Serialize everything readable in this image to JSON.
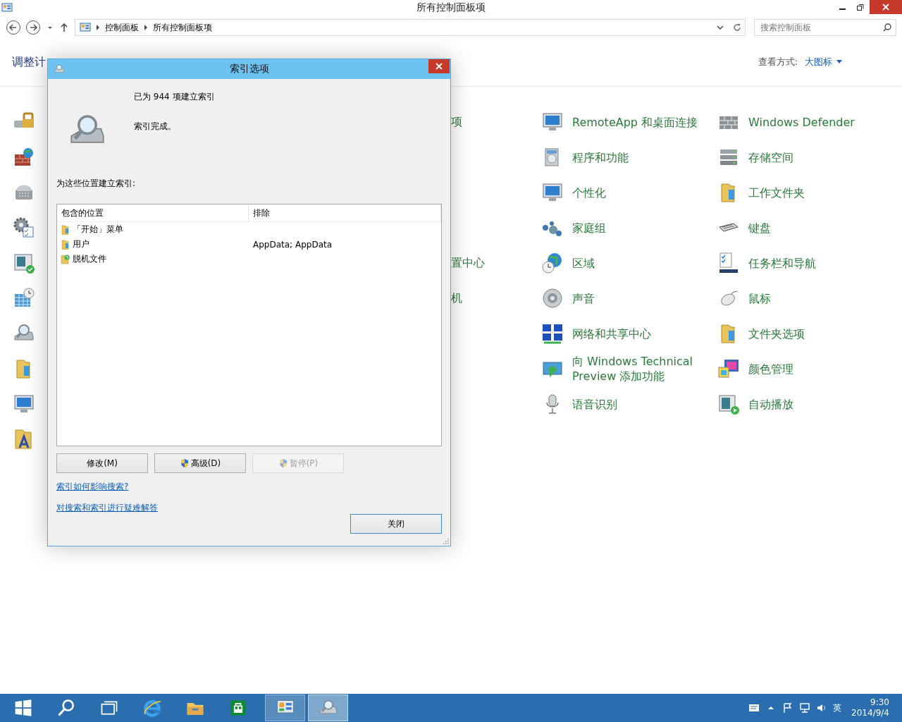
{
  "window": {
    "title": "所有控制面板项"
  },
  "address": {
    "breadcrumbs": [
      "控制面板",
      "所有控制面板项"
    ]
  },
  "search": {
    "placeholder": "搜索控制面板"
  },
  "header": {
    "title": "调整计",
    "view_label": "查看方式:",
    "view_value": "大图标"
  },
  "rows": [
    {
      "partial": "项",
      "items": [
        {
          "label": "RemoteApp 和桌面连接"
        },
        {
          "label": "Windows Defender"
        }
      ]
    },
    {
      "items": [
        {
          "label": "程序和功能"
        },
        {
          "label": "存储空间"
        }
      ]
    },
    {
      "items": [
        {
          "label": "个性化"
        },
        {
          "label": "工作文件夹"
        }
      ]
    },
    {
      "items": [
        {
          "label": "家庭组"
        },
        {
          "label": "键盘"
        }
      ]
    },
    {
      "partial": "置中心",
      "items": [
        {
          "label": "区域"
        },
        {
          "label": "任务栏和导航"
        }
      ]
    },
    {
      "partial": "机",
      "items": [
        {
          "label": "声音"
        },
        {
          "label": "鼠标"
        }
      ]
    },
    {
      "items": [
        {
          "label": "网络和共享中心"
        },
        {
          "label": "文件夹选项"
        }
      ]
    },
    {
      "items": [
        {
          "label": "向 Windows Technical Preview 添加功能"
        },
        {
          "label": "颜色管理"
        }
      ]
    },
    {
      "items": [
        {
          "label": "语音识别"
        },
        {
          "label": "自动播放"
        }
      ]
    }
  ],
  "dialog": {
    "title": "索引选项",
    "status_count": "已为 944 项建立索引",
    "status": "索引完成。",
    "locations_label": "为这些位置建立索引:",
    "columns": [
      "包含的位置",
      "排除"
    ],
    "locations": [
      {
        "kind": "folder",
        "location": "「开始」菜单"
      },
      {
        "kind": "folder",
        "location": "用户",
        "exclude": "AppData; AppData"
      },
      {
        "kind": "sync-folder",
        "location": "脱机文件"
      }
    ],
    "buttons": [
      {
        "label": "修改(M)",
        "shield": false,
        "disabled": false
      },
      {
        "label": "高级(D)",
        "shield": true,
        "disabled": false
      },
      {
        "label": "暂停(P)",
        "shield": true,
        "disabled": true
      }
    ],
    "links": [
      "索引如何影响搜索?",
      "对搜索和索引进行疑难解答"
    ],
    "close_button": "关闭"
  },
  "taskbar": {
    "apps": [
      {
        "kind": "start",
        "running": false,
        "selected": false
      },
      {
        "kind": "search",
        "running": false,
        "selected": false
      },
      {
        "kind": "task-view",
        "running": false,
        "selected": false
      },
      {
        "kind": "browser",
        "running": false,
        "selected": false
      },
      {
        "kind": "explorer",
        "running": false,
        "selected": false
      },
      {
        "kind": "store",
        "running": false,
        "selected": false
      },
      {
        "kind": "control-panel",
        "running": true,
        "selected": false
      },
      {
        "kind": "indexing",
        "running": true,
        "selected": true
      }
    ],
    "ime": "英",
    "time": "9:30",
    "date": "2014/9/4"
  }
}
